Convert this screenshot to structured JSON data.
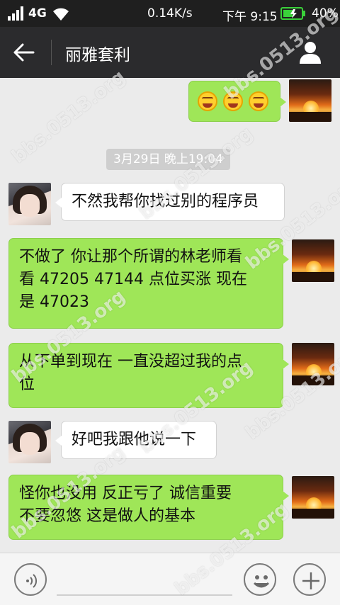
{
  "status_bar": {
    "network": "4G",
    "speed": "0.14K/s",
    "time": "下午 9:15",
    "battery": "40%"
  },
  "nav": {
    "title": "丽雅套利"
  },
  "chat": {
    "timestamp": "3月29日 晚上19:04",
    "messages": [
      {
        "side": "right",
        "type": "emoji",
        "text": ""
      },
      {
        "side": "left",
        "text": "不然我帮你找过别的程序员"
      },
      {
        "side": "right",
        "lines": [
          "不做了  你让那个所谓的林老师看",
          "看  47205  47144 点位买涨   现在",
          "是 47023"
        ]
      },
      {
        "side": "right",
        "lines": [
          "从下单到现在  一直没超过我的点",
          "位"
        ]
      },
      {
        "side": "left",
        "text": "好吧我跟他说一下"
      },
      {
        "side": "right",
        "lines": [
          "怪你也没用  反正亏了  诚信重要",
          "不要忽悠  这是做人的基本"
        ]
      }
    ]
  },
  "watermark": "bbs.0513.org",
  "colors": {
    "status_bg": "#1f1f1f",
    "nav_bg": "#2b2b2d",
    "chat_bg": "#ebebeb",
    "bubble_green": "#9fe658",
    "bubble_white": "#ffffff"
  },
  "icons": {
    "back": "arrow-left-icon",
    "profile": "person-icon",
    "voice": "voice-icon",
    "emoji": "smiley-icon",
    "plus": "plus-icon"
  }
}
